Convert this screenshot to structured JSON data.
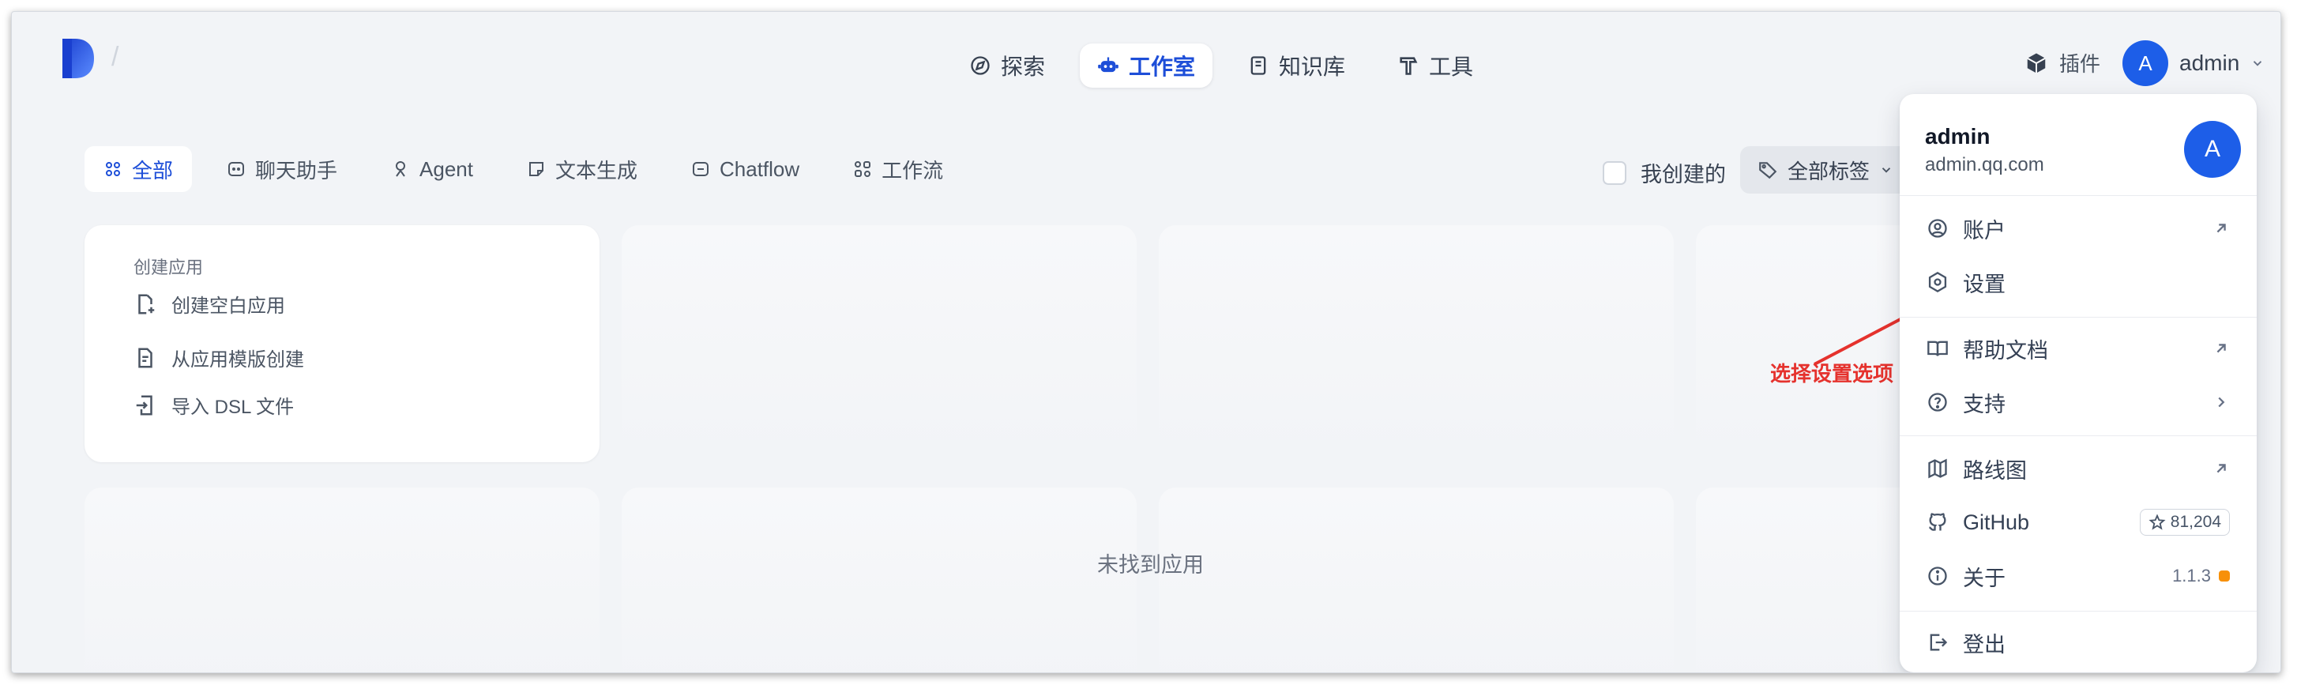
{
  "nav": {
    "explore": "探索",
    "studio": "工作室",
    "knowledge": "知识库",
    "tools": "工具"
  },
  "header": {
    "plugins": "插件",
    "user_initial": "A",
    "username": "admin"
  },
  "filters": {
    "all": "全部",
    "chat_assistant": "聊天助手",
    "agent": "Agent",
    "text_generation": "文本生成",
    "chatflow": "Chatflow",
    "workflow": "工作流"
  },
  "toolbar": {
    "created_by_me": "我创建的",
    "all_tags": "全部标签"
  },
  "create_card": {
    "title": "创建应用",
    "blank": "创建空白应用",
    "from_template": "从应用模版创建",
    "import_dsl": "导入 DSL 文件"
  },
  "empty_message": "未找到应用",
  "account_menu": {
    "name": "admin",
    "email": "admin.qq.com",
    "initial": "A",
    "account": "账户",
    "settings": "设置",
    "help_docs": "帮助文档",
    "support": "支持",
    "roadmap": "路线图",
    "github": "GitHub",
    "github_stars": "81,204",
    "about": "关于",
    "version": "1.1.3",
    "logout": "登出"
  },
  "annotation": "选择设置选项",
  "colors": {
    "accent": "#1d4ed8",
    "avatar": "#1d5ee8",
    "annotation": "#e5322d",
    "version_dot": "#f79009"
  }
}
